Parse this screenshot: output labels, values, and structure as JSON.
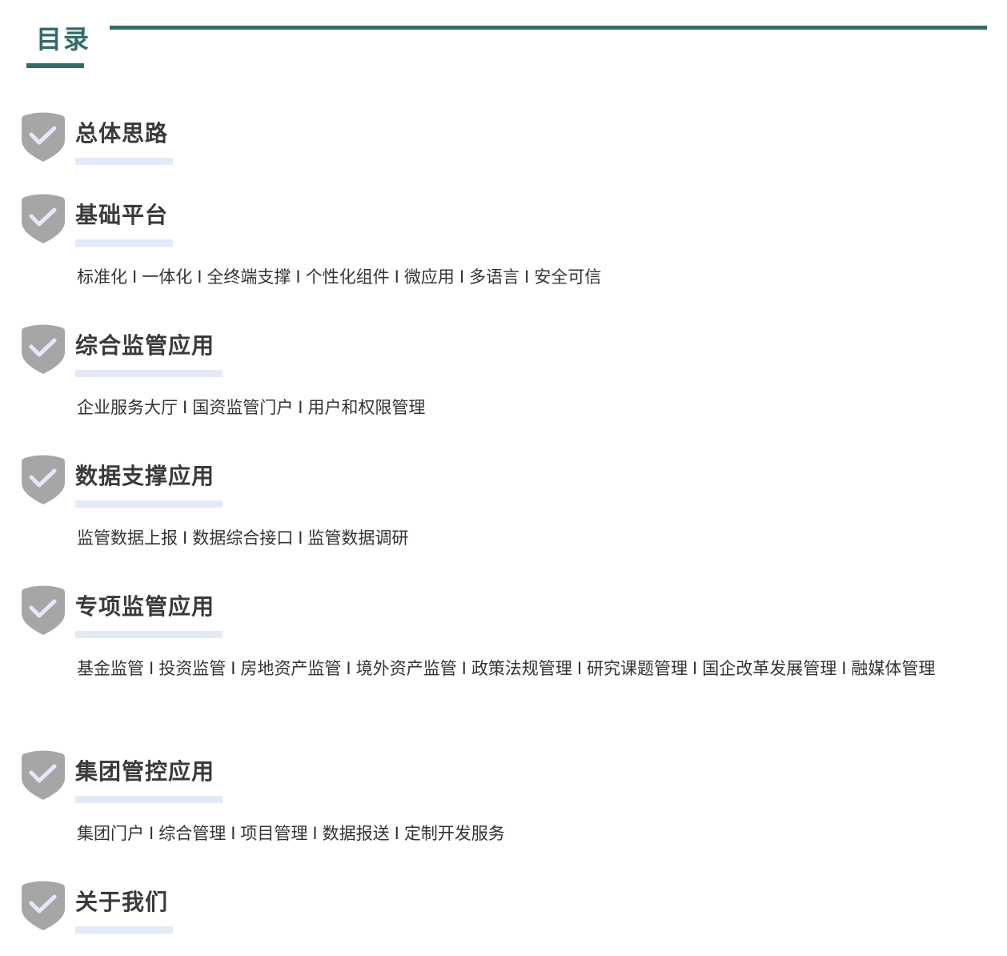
{
  "toc": {
    "title": "目录",
    "accent_color": "#336b6a"
  },
  "separator": "I",
  "sections": [
    {
      "title": "总体思路",
      "items": []
    },
    {
      "title": "基础平台",
      "items": [
        "标准化",
        "一体化",
        "全终端支撑",
        "个性化组件",
        "微应用",
        "多语言",
        "安全可信"
      ]
    },
    {
      "title": "综合监管应用",
      "items": [
        "企业服务大厅",
        "国资监管门户",
        "用户和权限管理"
      ]
    },
    {
      "title": "数据支撑应用",
      "items": [
        "监管数据上报",
        "数据综合接口",
        "监管数据调研"
      ]
    },
    {
      "title": "专项监管应用",
      "items": [
        "基金监管",
        "投资监管",
        "房地资产监管",
        "境外资产监管",
        "政策法规管理",
        "研究课题管理",
        "国企改革发展管理",
        "融媒体管理"
      ]
    },
    {
      "title": "集团管控应用",
      "items": [
        "集团门户",
        "综合管理",
        "项目管理",
        "数据报送",
        "定制开发服务"
      ]
    },
    {
      "title": "关于我们",
      "items": []
    }
  ],
  "icons": {
    "section_icon": "shield-check-icon"
  },
  "colors": {
    "shield": "#a6a6a6",
    "check": "#e4e8f8",
    "heading_bar": "#e4e9fa",
    "heading_text": "#3a3a3a"
  }
}
